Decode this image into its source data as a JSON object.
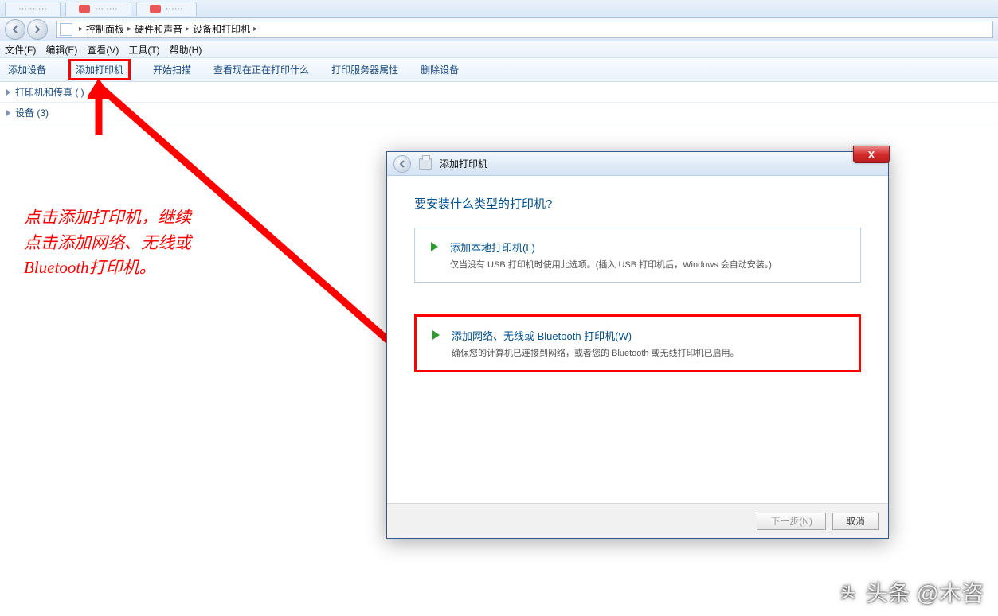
{
  "tabs": {
    "t1": "··· ······",
    "t2": "··· ····",
    "t3": "······"
  },
  "breadcrumb": {
    "c1": "控制面板",
    "c2": "硬件和声音",
    "c3": "设备和打印机"
  },
  "menubar": {
    "file": "文件(F)",
    "edit": "编辑(E)",
    "view": "查看(V)",
    "tools": "工具(T)",
    "help": "帮助(H)"
  },
  "toolbar": {
    "add_device": "添加设备",
    "add_printer": "添加打印机",
    "start_scan": "开始扫描",
    "see_printing": "查看现在正在打印什么",
    "server_props": "打印服务器属性",
    "remove_device": "删除设备"
  },
  "groups": {
    "printers_fax": "打印机和传真 (   )",
    "devices": "设备 (3)"
  },
  "annotation": {
    "l1": "点击添加打印机，继续",
    "l2": "点击添加网络、无线或",
    "l3": "Bluetooth打印机。"
  },
  "dialog": {
    "title": "添加打印机",
    "question": "要安装什么类型的打印机?",
    "opt1_title": "添加本地打印机(L)",
    "opt1_desc": "仅当没有 USB 打印机时使用此选项。(插入 USB 打印机后，Windows 会自动安装。)",
    "opt2_title": "添加网络、无线或 Bluetooth 打印机(W)",
    "opt2_desc": "确保您的计算机已连接到网络，或者您的 Bluetooth 或无线打印机已启用。",
    "next": "下一步(N)",
    "cancel": "取消",
    "close": "X"
  },
  "watermark": "头条 @木咨"
}
